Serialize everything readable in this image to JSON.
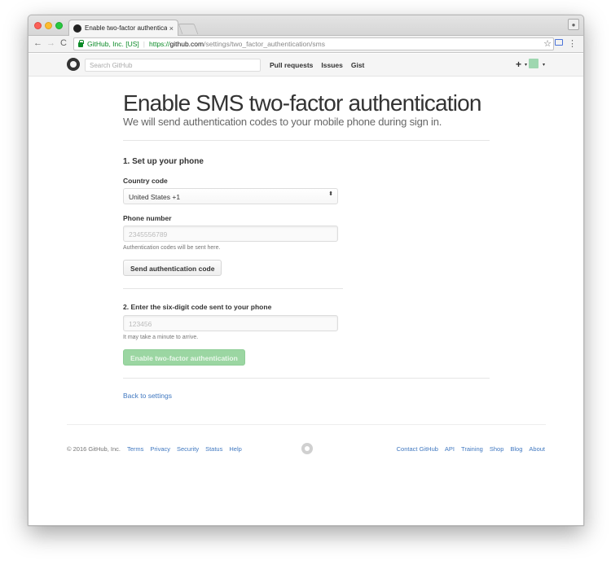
{
  "browser": {
    "tab_title": "Enable two-factor authenticati",
    "tab_close": "×",
    "ev_label": "GitHub, Inc. [US]",
    "url_scheme": "https://",
    "url_host": "github.com",
    "url_path": "/settings/two_factor_authentication/sms",
    "back_glyph": "←",
    "forward_glyph": "→",
    "reload_glyph": "C",
    "star_glyph": "☆",
    "menu_glyph": "⋮"
  },
  "gh_header": {
    "search_placeholder": "Search GitHub",
    "nav": [
      "Pull requests",
      "Issues",
      "Gist"
    ],
    "plus_glyph": "+",
    "caret_glyph": "▾"
  },
  "page": {
    "title": "Enable SMS two-factor authentication",
    "subtitle": "We will send authentication codes to your mobile phone during sign in.",
    "step1_heading": "1. Set up your phone",
    "country_label": "Country code",
    "country_value": "United States +1",
    "select_arrows": "⬍",
    "phone_label": "Phone number",
    "phone_placeholder": "2345556789",
    "phone_hint": "Authentication codes will be sent here.",
    "send_button": "Send authentication code",
    "step2_heading": "2. Enter the six-digit code sent to your phone",
    "code_placeholder": "123456",
    "code_hint": "It may take a minute to arrive.",
    "enable_button": "Enable two-factor authentication",
    "back_link": "Back to settings"
  },
  "footer": {
    "copyright": "© 2016 GitHub, Inc.",
    "left_links": [
      "Terms",
      "Privacy",
      "Security",
      "Status",
      "Help"
    ],
    "right_links": [
      "Contact GitHub",
      "API",
      "Training",
      "Shop",
      "Blog",
      "About"
    ]
  }
}
